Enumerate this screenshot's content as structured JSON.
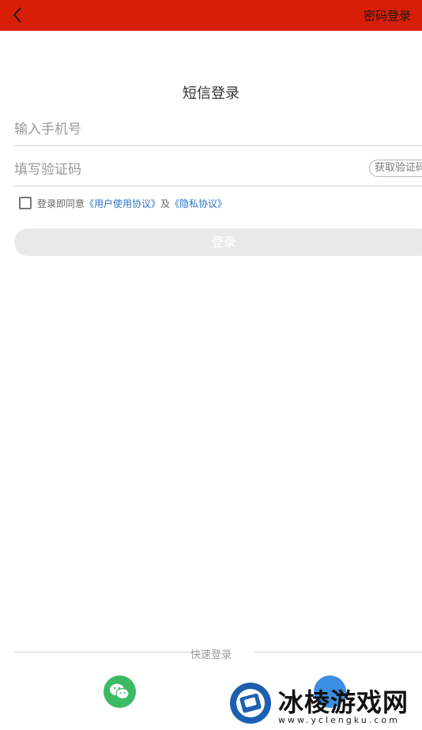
{
  "header": {
    "right_label": "密码登录"
  },
  "page_title": "短信登录",
  "phone_field": {
    "placeholder": "输入手机号"
  },
  "code_field": {
    "placeholder": "填写验证码",
    "get_code_label": "获取验证码"
  },
  "agreement": {
    "prefix": "登录即同意",
    "user_agreement": "《用户使用协议》",
    "conjunction": "及",
    "privacy_policy": "《隐私协议》"
  },
  "login_button": {
    "label": "登录"
  },
  "quick_login": {
    "label": "快速登录"
  },
  "watermark": {
    "text": "冰棱游戏网",
    "url": "www.yclengku.com"
  },
  "colors": {
    "header": "#d81e06",
    "link": "#2a74c9",
    "wechat": "#3cbb64",
    "qq": "#3b8fe3"
  }
}
